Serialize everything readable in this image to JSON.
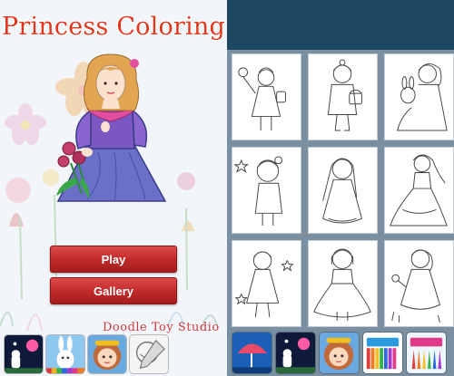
{
  "left": {
    "title": "Princess Coloring",
    "buttons": {
      "play": "Play",
      "gallery": "Gallery"
    },
    "studio": "Doodle Toy Studio",
    "dock_icons": [
      "night-garden-icon",
      "bunny-paint-icon",
      "girl-face-icon",
      "sketch-icon"
    ]
  },
  "right": {
    "gallery_items": [
      "girl-with-balloon",
      "girl-with-basket",
      "girl-with-bunny",
      "girl-with-star",
      "girl-long-hair",
      "princess-gown",
      "girl-with-stars",
      "girl-in-dress",
      "girl-with-flowers"
    ],
    "dock_icons": [
      "umbrella-icon",
      "night-garden-icon",
      "girl-face-icon",
      "crayons-icon",
      "coloring-pencils-icon"
    ]
  },
  "colors": {
    "title_red": "#e2371e",
    "button_red": "#c12b2b",
    "right_topbar": "#1e4762",
    "right_background": "#7a8fa0"
  }
}
